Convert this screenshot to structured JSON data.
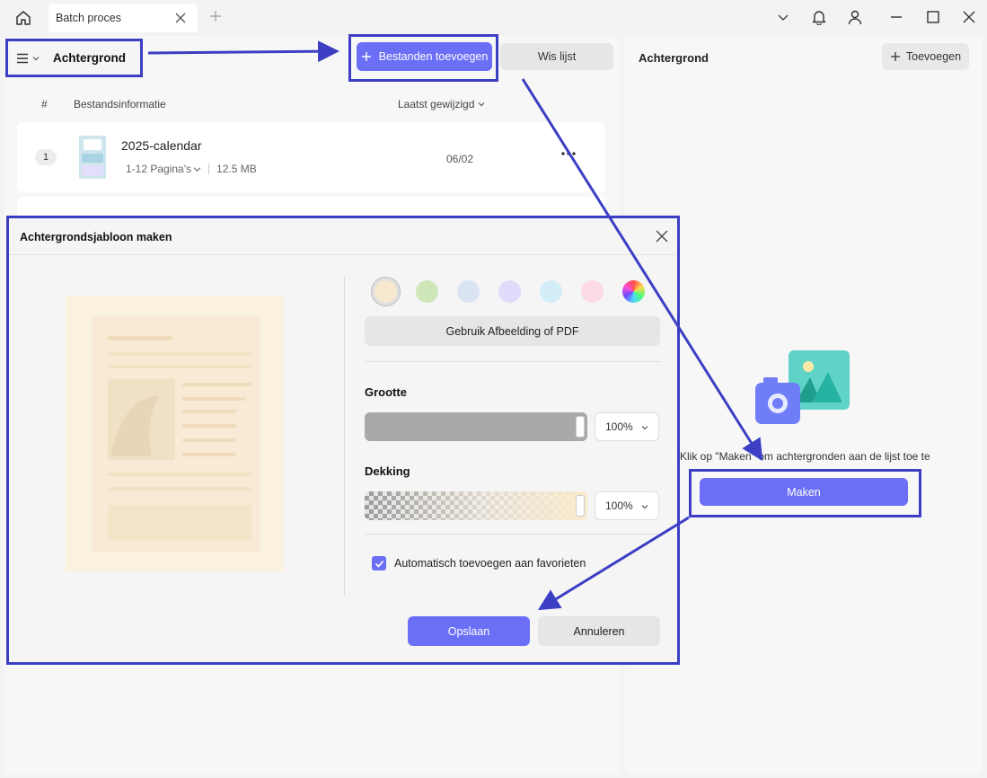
{
  "window": {
    "tab_title": "Batch proces"
  },
  "sidebar_header": {
    "title": "Achtergrond"
  },
  "toolbar": {
    "add_files_label": "Bestanden toevoegen",
    "clear_list_label": "Wis lijst"
  },
  "file_list": {
    "columns": {
      "number": "#",
      "info": "Bestandsinformatie",
      "modified": "Laatst gewijzigd"
    },
    "rows": [
      {
        "index": "1",
        "name": "2025-calendar",
        "pages": "1-12 Pagina's",
        "size": "12.5 MB",
        "date": "06/02"
      }
    ]
  },
  "right_panel": {
    "title": "Achtergrond",
    "add_label": "Toevoegen",
    "empty_text": "Klik op \"Maken\" om achtergronden aan de lijst toe te",
    "make_label": "Maken"
  },
  "dialog": {
    "title": "Achtergrondsjabloon maken",
    "swatch_colors": [
      "#f6e9cf",
      "#cfe6b8",
      "#d9e3f2",
      "#e2dafb",
      "#d3edf7",
      "#fbd9e7"
    ],
    "selected_swatch": 0,
    "use_image_label": "Gebruik Afbeelding of PDF",
    "size_label": "Grootte",
    "size_value": "100%",
    "opacity_label": "Dekking",
    "opacity_value": "100%",
    "auto_favorite_label": "Automatisch toevoegen aan favorieten",
    "auto_favorite_checked": true,
    "save_label": "Opslaan",
    "cancel_label": "Annuleren"
  },
  "colors": {
    "accent": "#6b6ff5",
    "annotation": "#3c3ec3"
  }
}
